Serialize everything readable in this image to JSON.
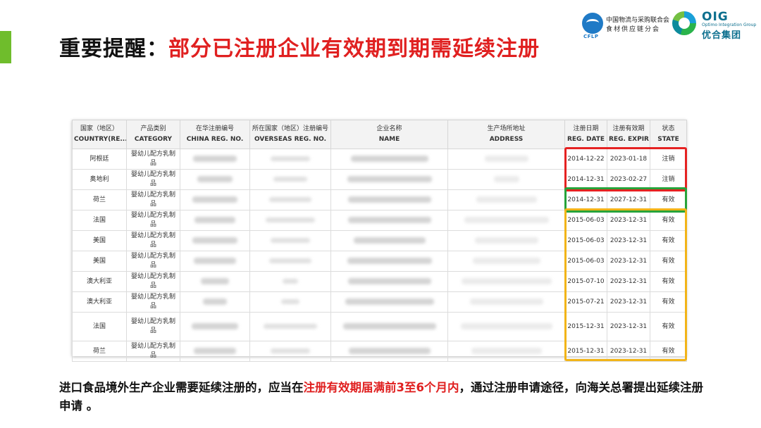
{
  "slide": {
    "title_prefix": "重要提醒：",
    "title_highlight": "部分已注册企业有效期到期需延续注册"
  },
  "logos": {
    "cflp": {
      "abbr": "CFLP",
      "line1": "中国物流与采购联合会",
      "line2": "食材供应链分会",
      "color": "#1f7ac6"
    },
    "oig": {
      "abbr": "OIG",
      "sub": "Optimo Integration Group",
      "cn": "优合集团",
      "color": "#0c6f8e"
    }
  },
  "table": {
    "headers": [
      {
        "cn": "国家（地区）",
        "en": "COUNTRY(RE..."
      },
      {
        "cn": "产品类别",
        "en": "CATEGORY"
      },
      {
        "cn": "在华注册编号",
        "en": "CHINA REG. NO."
      },
      {
        "cn": "所在国家（地区）注册编号",
        "en": "OVERSEAS REG. NO."
      },
      {
        "cn": "企业名称",
        "en": "NAME"
      },
      {
        "cn": "生产场所地址",
        "en": "ADDRESS"
      },
      {
        "cn": "注册日期",
        "en": "REG. DATE"
      },
      {
        "cn": "注册有效期",
        "en": "REG. EXPIR..."
      },
      {
        "cn": "状态",
        "en": "STATE"
      }
    ],
    "rows": [
      {
        "country": "阿根廷",
        "category": "婴幼儿配方乳制品",
        "reg_date": "2014-12-22",
        "expiry": "2023-01-18",
        "state": "注销"
      },
      {
        "country": "奥地利",
        "category": "婴幼儿配方乳制品",
        "reg_date": "2014-12-31",
        "expiry": "2023-02-27",
        "state": "注销"
      },
      {
        "country": "荷兰",
        "category": "婴幼儿配方乳制品",
        "reg_date": "2014-12-31",
        "expiry": "2027-12-31",
        "state": "有效"
      },
      {
        "country": "法国",
        "category": "婴幼儿配方乳制品",
        "reg_date": "2015-06-03",
        "expiry": "2023-12-31",
        "state": "有效"
      },
      {
        "country": "美国",
        "category": "婴幼儿配方乳制品",
        "reg_date": "2015-06-03",
        "expiry": "2023-12-31",
        "state": "有效"
      },
      {
        "country": "美国",
        "category": "婴幼儿配方乳制品",
        "reg_date": "2015-06-03",
        "expiry": "2023-12-31",
        "state": "有效"
      },
      {
        "country": "澳大利亚",
        "category": "婴幼儿配方乳制品",
        "reg_date": "2015-07-10",
        "expiry": "2023-12-31",
        "state": "有效"
      },
      {
        "country": "澳大利亚",
        "category": "婴幼儿配方乳制品",
        "reg_date": "2015-07-21",
        "expiry": "2023-12-31",
        "state": "有效"
      },
      {
        "country": "法国",
        "category": "婴幼儿配方乳制品",
        "reg_date": "2015-12-31",
        "expiry": "2023-12-31",
        "state": "有效"
      },
      {
        "country": "荷兰",
        "category": "婴幼儿配方乳制品",
        "reg_date": "2015-12-31",
        "expiry": "2023-12-31",
        "state": "有效"
      }
    ]
  },
  "highlight_colors": {
    "cancelled": "#e52222",
    "valid_long": "#27a33a",
    "expiring": "#f2b418"
  },
  "footnote": {
    "part1": "进口食品境外生产企业需要延续注册的，应当在",
    "highlight": "注册有效期届满前3至6个月内",
    "part2": "，通过注册申请途径，向海关总署提出延续注册申请 。"
  },
  "colors": {
    "accent": "#6fbd2c",
    "highlight_text": "#e02020"
  }
}
